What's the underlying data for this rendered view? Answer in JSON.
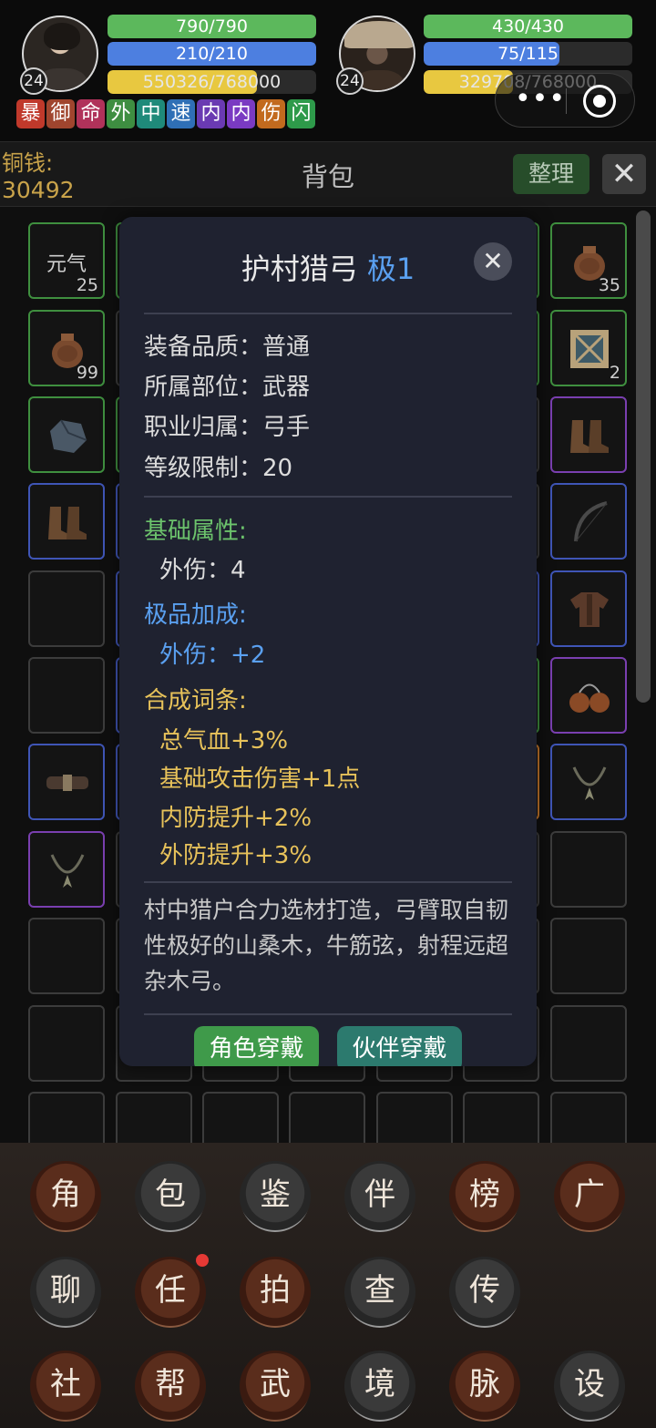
{
  "player": {
    "level": "24",
    "hp": "790/790",
    "mp": "210/210",
    "xp": "550326/768000",
    "hp_fill": 1.0,
    "mp_fill": 1.0,
    "xp_fill": 0.7166
  },
  "partner": {
    "level": "24",
    "hp": "430/430",
    "mp": "75/115",
    "xp": "329708/768000",
    "hp_fill": 1.0,
    "mp_fill": 0.652,
    "xp_fill": 0.4293
  },
  "tags": [
    {
      "label": "暴",
      "color": "#c0392b"
    },
    {
      "label": "御",
      "color": "#a0452e"
    },
    {
      "label": "命",
      "color": "#b0325a"
    },
    {
      "label": "外",
      "color": "#3e8e41"
    },
    {
      "label": "中",
      "color": "#1f8a7a"
    },
    {
      "label": "速",
      "color": "#2f6fb6"
    },
    {
      "label": "内",
      "color": "#6a3ab2"
    },
    {
      "label": "内",
      "color": "#7a3ac2"
    },
    {
      "label": "伤",
      "color": "#c26a1e"
    },
    {
      "label": "闪",
      "color": "#2e9a4a"
    }
  ],
  "capsule": {
    "more_icon": "more-dots-icon",
    "close_icon": "target-icon"
  },
  "bag": {
    "money_label": "铜钱:",
    "money_value": "30492",
    "title": "背包",
    "sort_label": "整理",
    "close_icon": "✕"
  },
  "slots_visible": {
    "r0c0_name": "元气",
    "r0c0_count": "25",
    "r0c6_count": "35",
    "r1c0_count": "99",
    "r1c6_count": "2"
  },
  "tooltip": {
    "name": "护村猎弓",
    "grade": "极1",
    "close_icon": "✕",
    "quality": "装备品质：普通",
    "slot": "所属部位：武器",
    "class": "职业归属：弓手",
    "level_req": "等级限制：20",
    "base_header": "基础属性:",
    "base_attr": "外伤：4",
    "bonus_header": "极品加成:",
    "bonus_attr": "外伤：+2",
    "affix_header": "合成词条:",
    "affixes": [
      "总气血+3%",
      "基础攻击伤害+1点",
      "内防提升+2%",
      "外防提升+3%"
    ],
    "description": "村中猎户合力选材打造，弓臂取自韧性极好的山桑木，牛筋弦，射程远超杂木弓。",
    "btn_role": "角色穿戴",
    "btn_partner": "伙伴穿戴"
  },
  "menu": {
    "row1": [
      "角",
      "包",
      "鉴",
      "伴",
      "榜",
      "广"
    ],
    "row2": [
      "聊",
      "任",
      "拍",
      "查",
      "传"
    ],
    "row3": [
      "社",
      "帮",
      "武",
      "境",
      "脉",
      "设"
    ]
  }
}
